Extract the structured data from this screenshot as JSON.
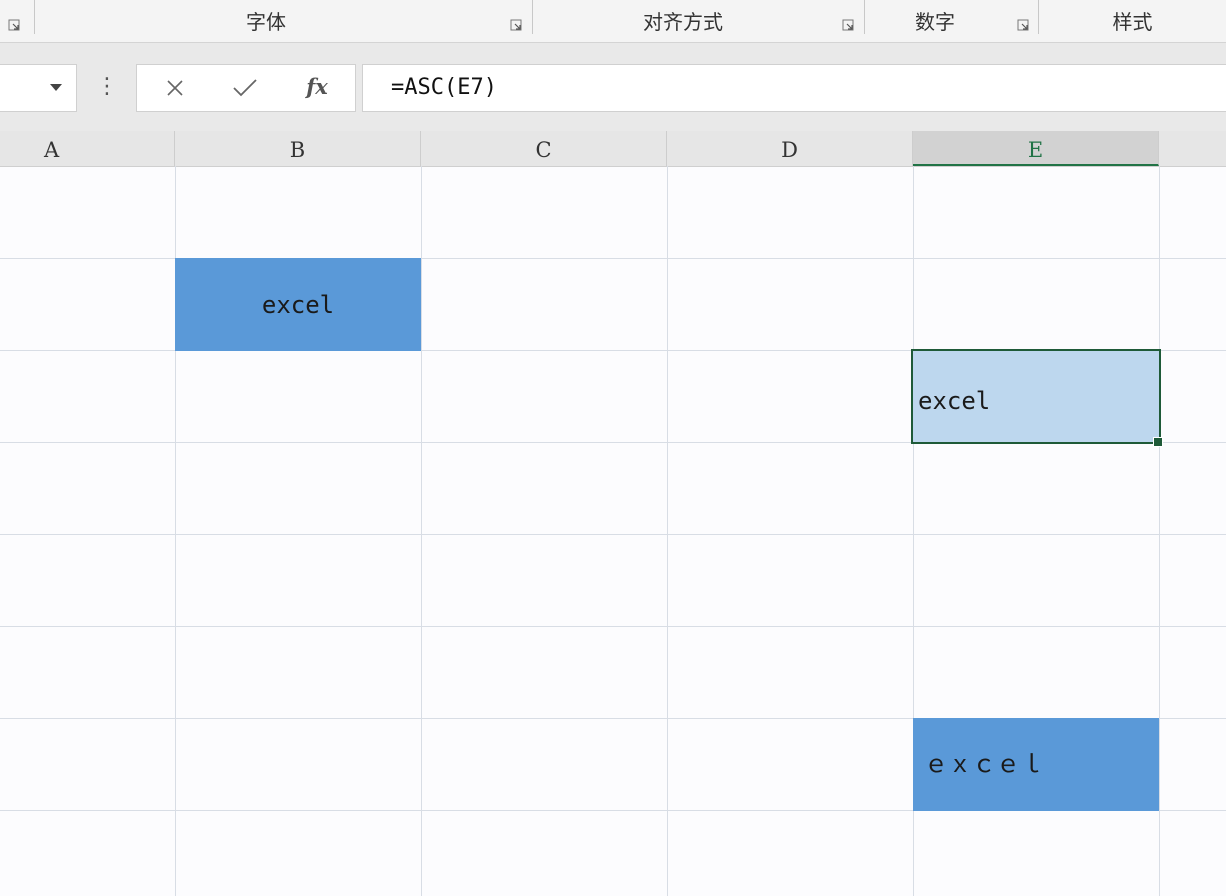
{
  "ribbon": {
    "groups": [
      {
        "id": "font",
        "label": "字体"
      },
      {
        "id": "alignment",
        "label": "对齐方式"
      },
      {
        "id": "number",
        "label": "数字"
      },
      {
        "id": "styles",
        "label": "样式"
      }
    ]
  },
  "formula_bar": {
    "name_box_value": "",
    "cancel_icon": "close-icon",
    "enter_icon": "checkmark-icon",
    "function_label": "fx",
    "formula": "=ASC(E7)"
  },
  "columns": [
    "A",
    "B",
    "C",
    "D",
    "E"
  ],
  "active_column": "E",
  "cells": {
    "B2": "excel",
    "E3": "excel",
    "E7": "ｅｘｃｅｌ"
  },
  "colors": {
    "selection_border": "#1e5a38",
    "blue_fill": "#5a99d8",
    "light_blue_fill": "#bdd7ee"
  }
}
